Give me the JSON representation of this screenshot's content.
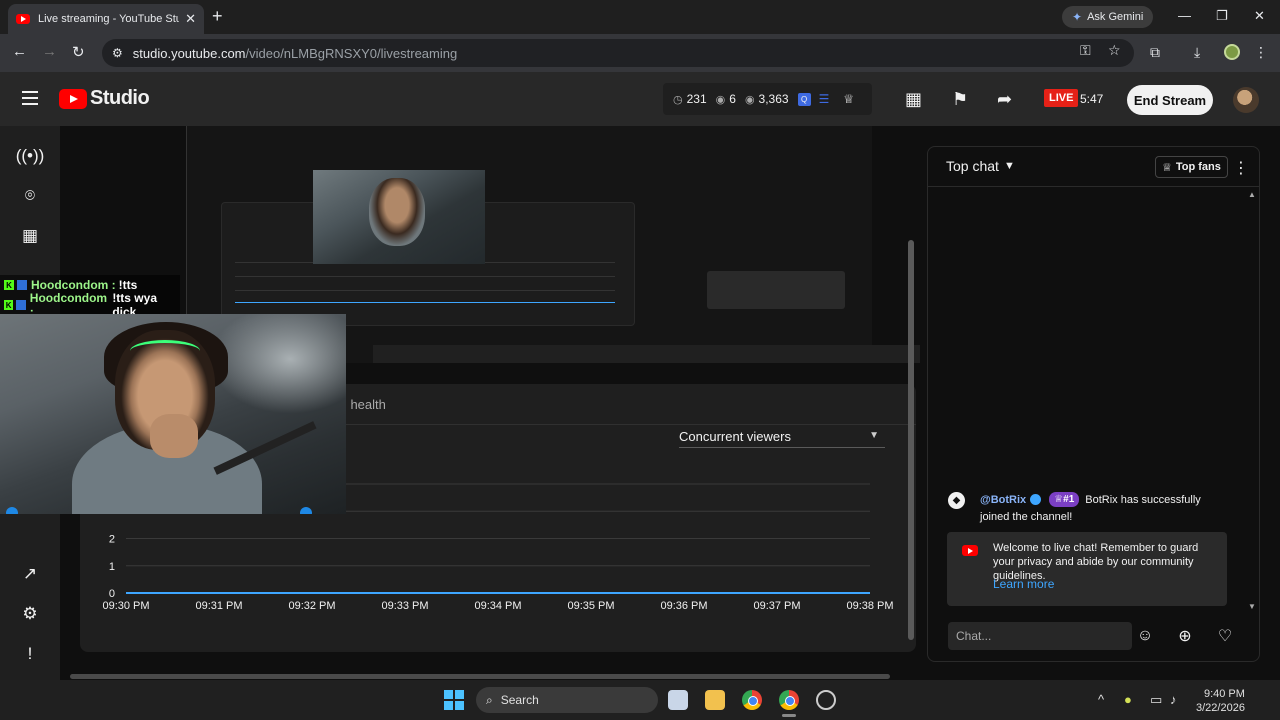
{
  "browser": {
    "tab_title": "Live streaming - YouTube Studi",
    "gemini_label": "Ask Gemini",
    "url_host": "studio.youtube.com",
    "url_path": "/video/nLMBgRNSXY0/livestreaming"
  },
  "header": {
    "logo_text": "Studio",
    "stats": {
      "watching": "231",
      "likes": "6",
      "views": "3,363"
    },
    "live_label": "LIVE",
    "live_time": "5:47",
    "end_stream_label": "End Stream"
  },
  "stream_overlay": {
    "chat_lines": [
      {
        "user": "Hoodcondom :",
        "text": "!tts"
      },
      {
        "user": "Hoodcondom :",
        "text": "!tts wya dick"
      }
    ]
  },
  "health": {
    "title_fragment": "m health",
    "metric_select": "Concurrent viewers"
  },
  "chart_data": {
    "type": "line",
    "title": "",
    "xlabel": "",
    "ylabel": "",
    "x": [
      "09:30 PM",
      "09:31 PM",
      "09:32 PM",
      "09:33 PM",
      "09:34 PM",
      "09:35 PM",
      "09:36 PM",
      "09:37 PM",
      "09:38 PM"
    ],
    "y_ticks": [
      "0",
      "1",
      "2"
    ],
    "series": [
      {
        "values": [
          0,
          0,
          0,
          0,
          0,
          0,
          0,
          0,
          0
        ]
      }
    ],
    "grid": true,
    "line_color": "#3ea6ff"
  },
  "chat": {
    "header": "Top chat",
    "top_fans_label": "Top fans",
    "message": {
      "author": "@BotRix",
      "badge": "#1",
      "text_part1": "BotRix has successfully",
      "text_part2": "joined the channel!"
    },
    "welcome_text": "Welcome to live chat! Remember to guard your privacy and abide by our community guidelines.",
    "learn_more": "Learn more",
    "input_placeholder": "Chat..."
  },
  "taskbar": {
    "search_label": "Search",
    "time": "9:40 PM",
    "date": "3/22/2026"
  },
  "icons": {
    "accent": "#3ea6ff",
    "live_red": "#e62117"
  }
}
